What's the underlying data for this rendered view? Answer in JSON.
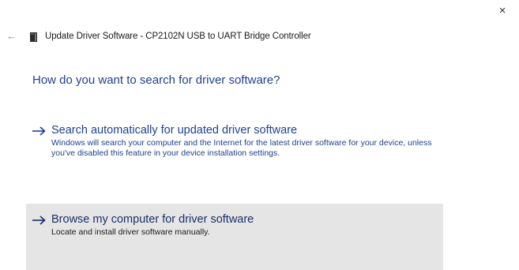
{
  "window": {
    "close_glyph": "×",
    "back_glyph": "←",
    "title": "Update Driver Software - CP2102N USB to UART Bridge Controller"
  },
  "main": {
    "heading": "How do you want to search for driver software?",
    "options": [
      {
        "title": "Search automatically for updated driver software",
        "description": "Windows will search your computer and the Internet for the latest driver software for your device, unless you've disabled this feature in your device installation settings.",
        "icon": "arrow-right-icon",
        "highlighted": false
      },
      {
        "title": "Browse my computer for driver software",
        "description": "Locate and install driver software manually.",
        "icon": "arrow-right-icon",
        "highlighted": true
      }
    ]
  },
  "colors": {
    "accent": "#1f3f8f",
    "highlight_bg": "#e5e5e5",
    "background": "#ffffff"
  }
}
